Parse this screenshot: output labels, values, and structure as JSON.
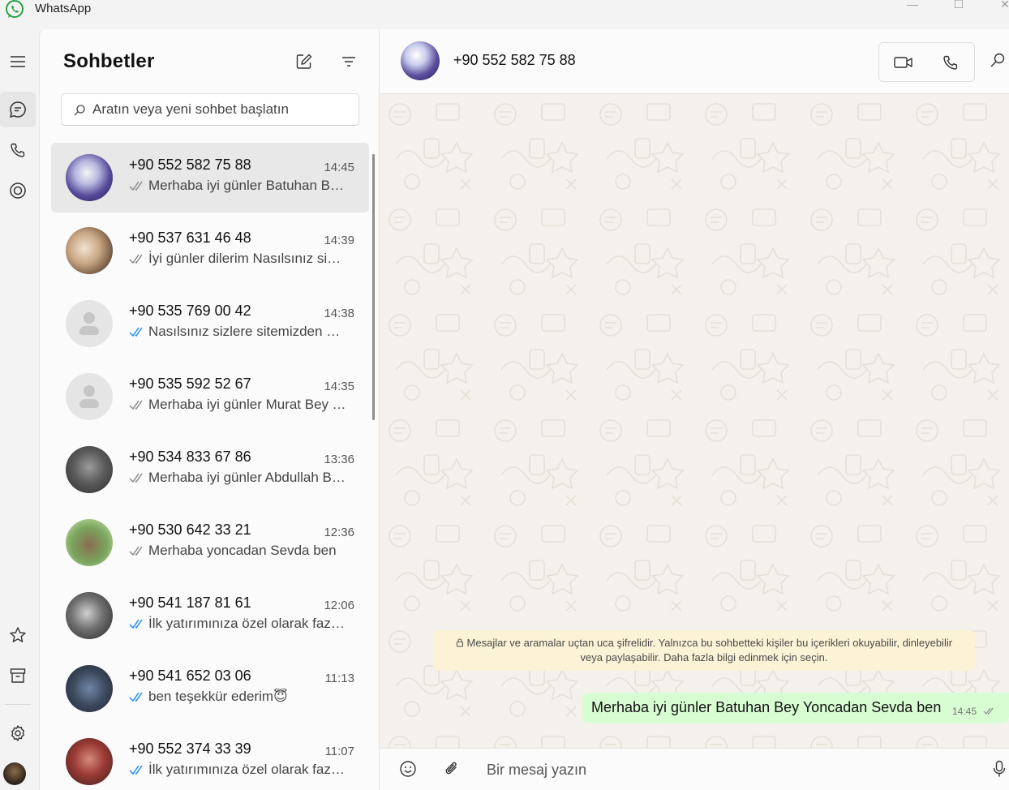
{
  "window": {
    "title": "WhatsApp",
    "controls": {
      "minimize": "—",
      "maximize": "☐",
      "close": "✕"
    }
  },
  "accent_color": "#1a8d5f",
  "rail": {
    "items": [
      {
        "name": "menu",
        "icon": "hamburger-icon"
      },
      {
        "name": "chats",
        "icon": "chat-bubble-icon",
        "active": true
      },
      {
        "name": "calls",
        "icon": "phone-icon"
      },
      {
        "name": "status",
        "icon": "status-ring-icon"
      },
      {
        "name": "starred",
        "icon": "star-icon"
      },
      {
        "name": "archived",
        "icon": "archive-icon"
      },
      {
        "name": "settings",
        "icon": "gear-icon"
      },
      {
        "name": "profile",
        "icon": "profile-avatar"
      }
    ]
  },
  "chats_panel": {
    "title": "Sohbetler",
    "new_chat_icon": "new-chat-icon",
    "filter_icon": "filter-icon",
    "search_placeholder": "Aratın veya yeni sohbet başlatın",
    "chats": [
      {
        "name": "+90 552 582 75 88",
        "time": "14:45",
        "preview": "Merhaba iyi günler  Batuhan Bey Yoncadan  Sevda ben",
        "ticks": "delivered",
        "selected": true,
        "avatar": "photo"
      },
      {
        "name": "+90 537 631 46 48",
        "time": "14:39",
        "preview": "İyi günler dilerim Nasılsınız sizlere sitemizden bahsetmek istiyorum",
        "ticks": "delivered",
        "avatar": "photo"
      },
      {
        "name": "+90 535 769 00 42",
        "time": "14:38",
        "preview": "Nasılsınız sizlere sitemizden bahsetmek istiyorum",
        "ticks": "read",
        "avatar": "placeholder"
      },
      {
        "name": "+90 535 592 52 67",
        "time": "14:35",
        "preview": "Merhaba iyi günler Murat Bey Yoncadan Sevda ben",
        "ticks": "delivered",
        "avatar": "placeholder"
      },
      {
        "name": "+90 534 833 67 86",
        "time": "13:36",
        "preview": "Merhaba iyi günler Abdullah Bey Yoncadan Sevda ben",
        "ticks": "delivered",
        "avatar": "photo"
      },
      {
        "name": "+90 530 642 33 21",
        "time": "12:36",
        "preview": "Merhaba yoncadan Sevda ben",
        "ticks": "delivered",
        "avatar": "photo"
      },
      {
        "name": "+90 541 187 81 61",
        "time": "12:06",
        "preview": "İlk yatırımınıza özel olarak fazladan bonus",
        "ticks": "read",
        "avatar": "photo"
      },
      {
        "name": "+90 541 652 03 06",
        "time": "11:13",
        "preview": "ben teşekkür ederim😇",
        "ticks": "read",
        "avatar": "photo"
      },
      {
        "name": "+90 552 374 33 39",
        "time": "11:07",
        "preview": "İlk yatırımınıza özel olarak fazladan bonus",
        "ticks": "read",
        "avatar": "photo"
      }
    ]
  },
  "conversation": {
    "contact_name": "+90 552 582 75 88",
    "video_call_icon": "video-camera-icon",
    "voice_call_icon": "phone-icon",
    "search_icon": "search-icon",
    "encryption_notice_line1": "Mesajlar ve aramalar uçtan uca şifrelidir. Yalnızca bu sohbetteki kişiler bu içerikleri okuyabilir, dinleyebilir",
    "encryption_notice_line2": "veya paylaşabilir. Daha fazla bilgi edinmek için seçin.",
    "messages": [
      {
        "text": "Merhaba iyi günler  Batuhan Bey Yoncadan  Sevda ben",
        "time": "14:45",
        "outgoing": true,
        "ticks": "delivered"
      }
    ],
    "composer": {
      "placeholder": "Bir mesaj yazın",
      "emoji_icon": "emoji-icon",
      "attach_icon": "paperclip-icon",
      "mic_icon": "microphone-icon"
    }
  }
}
